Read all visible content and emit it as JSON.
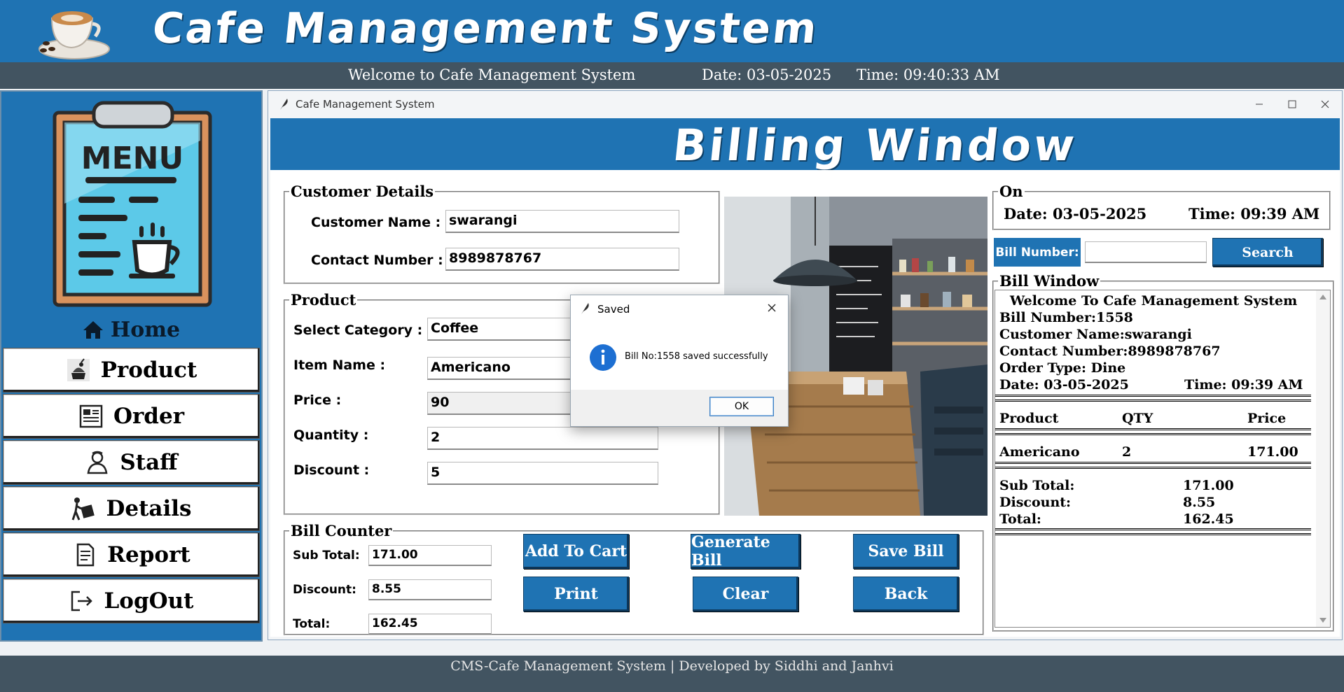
{
  "header": {
    "title": "Cafe Management System",
    "welcome": "Welcome to Cafe Management System",
    "date": "Date: 03-05-2025",
    "time": "Time: 09:40:33 AM"
  },
  "sidebar": {
    "home": "Home",
    "menu_word": "MENU",
    "items": [
      {
        "label": "Product",
        "icon": "cake-icon"
      },
      {
        "label": "Order",
        "icon": "order-icon"
      },
      {
        "label": "Staff",
        "icon": "staff-icon"
      },
      {
        "label": "Details",
        "icon": "details-icon"
      },
      {
        "label": "Report",
        "icon": "report-icon"
      },
      {
        "label": "LogOut",
        "icon": "logout-icon"
      }
    ]
  },
  "window": {
    "title": "Cafe Management System",
    "banner": "Billing Window"
  },
  "customer": {
    "legend": "Customer Details",
    "name_label": "Customer Name :",
    "name_value": "swarangi",
    "contact_label": "Contact Number :",
    "contact_value": "8989878767"
  },
  "product": {
    "legend": "Product",
    "category_label": "Select Category :",
    "category_value": "Coffee",
    "item_label": "Item Name :",
    "item_value": "Americano",
    "price_label": "Price :",
    "price_value": "90",
    "qty_label": "Quantity :",
    "qty_value": "2",
    "discount_label": "Discount :",
    "discount_value": "5"
  },
  "bill_counter": {
    "legend": "Bill Counter",
    "subtotal_label": "Sub Total:",
    "subtotal_value": "171.00",
    "discount_label": "Discount:",
    "discount_value": "8.55",
    "total_label": "Total:",
    "total_value": "162.45",
    "buttons": {
      "add_to_cart": "Add To Cart",
      "generate_bill": "Generate Bill",
      "save_bill": "Save Bill",
      "print": "Print",
      "clear": "Clear",
      "back": "Back"
    }
  },
  "on_panel": {
    "legend": "On",
    "date": "Date: 03-05-2025",
    "time": "Time: 09:39 AM"
  },
  "search": {
    "label": "Bill Number:",
    "value": "",
    "button": "Search"
  },
  "bill_window": {
    "legend": "Bill Window",
    "heading": "Welcome To Cafe Management System",
    "bill_number": "Bill Number:1558",
    "customer_name": "Customer Name:swarangi",
    "contact": "Contact Number:8989878767",
    "order_type": "Order Type: Dine",
    "date": "Date: 03-05-2025",
    "time": "Time: 09:39 AM",
    "col_product": "Product",
    "col_qty": "QTY",
    "col_price": "Price",
    "item_name": "Americano",
    "item_qty": "2",
    "item_price": "171.00",
    "subtotal_label": "Sub Total:",
    "subtotal_value": "171.00",
    "discount_label": "Discount:",
    "discount_value": "8.55",
    "total_label": "Total:",
    "total_value": "162.45"
  },
  "dialog": {
    "title": "Saved",
    "message": "Bill No:1558 saved successfully",
    "ok": "OK"
  },
  "footer": {
    "text": "CMS-Cafe Management System | Developed by Siddhi and Janhvi"
  },
  "colors": {
    "brand_blue": "#1f73b3",
    "bar_gray": "#425461"
  }
}
